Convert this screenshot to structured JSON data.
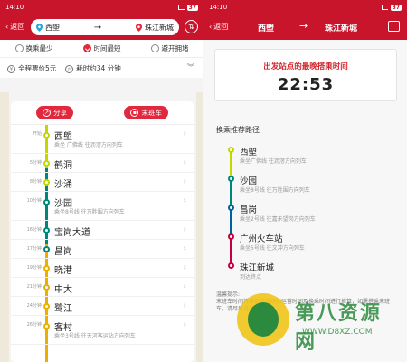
{
  "status": {
    "time": "14:10",
    "battery": "37"
  },
  "left": {
    "back": "返回",
    "origin": "西塱",
    "destination": "珠江新城",
    "options": [
      "换乘最少",
      "时间最短",
      "避开拥堵"
    ],
    "fare": "全程票价5元",
    "duration": "耗时约34 分钟",
    "share": "分享",
    "last_train": "末班车",
    "stops": [
      {
        "time": "开始",
        "name": "西塱",
        "sub": "乘坐 广佛线 往沥滘方向列车"
      },
      {
        "time": "5分钟",
        "name": "鹤洞",
        "sub": ""
      },
      {
        "time": "8分钟",
        "name": "沙涌",
        "sub": ""
      },
      {
        "time": "10分钟",
        "name": "沙园",
        "sub": "乘坐8号线 往万胜围方向列车"
      },
      {
        "time": "16分钟",
        "name": "宝岗大道",
        "sub": ""
      },
      {
        "time": "17分钟",
        "name": "昌岗",
        "sub": ""
      },
      {
        "time": "19分钟",
        "name": "晓港",
        "sub": ""
      },
      {
        "time": "21分钟",
        "name": "中大",
        "sub": ""
      },
      {
        "time": "24分钟",
        "name": "鹭江",
        "sub": ""
      },
      {
        "time": "26分钟",
        "name": "客村",
        "sub": "乘坐3号线 往天河客运站方向列车"
      }
    ]
  },
  "right": {
    "back": "返回",
    "from": "西塱",
    "to": "珠江新城",
    "last_title": "出发站点的最晚搭乘时间",
    "last_time": "22:53",
    "section": "换乘推荐路径",
    "stops": [
      {
        "name": "西塱",
        "sub": "乘坐广佛线 往沥滘方向列车"
      },
      {
        "name": "沙园",
        "sub": "乘坐8号线 往万胜围方向列车"
      },
      {
        "name": "昌岗",
        "sub": "乘坐2号线 往嘉禾望岗方向列车"
      },
      {
        "name": "广州火车站",
        "sub": "乘坐5号线 往文冲方向列车"
      },
      {
        "name": "珠江新城",
        "sub": "到达终点"
      }
    ],
    "tip": "温馨提示:\n末班车时间将根据各线路的运营时间及换乘时间进行推算，如需搭乘末班车，请尽早进站。"
  },
  "watermark": {
    "text": "第八资源网",
    "url": "WWW.D8XZ.COM"
  },
  "colors": {
    "brand": "#c9152b",
    "guangfo": "#c4d600",
    "line8": "#00857a",
    "line2": "#00629b",
    "line3": "#ecae00",
    "line5": "#c5003e"
  }
}
